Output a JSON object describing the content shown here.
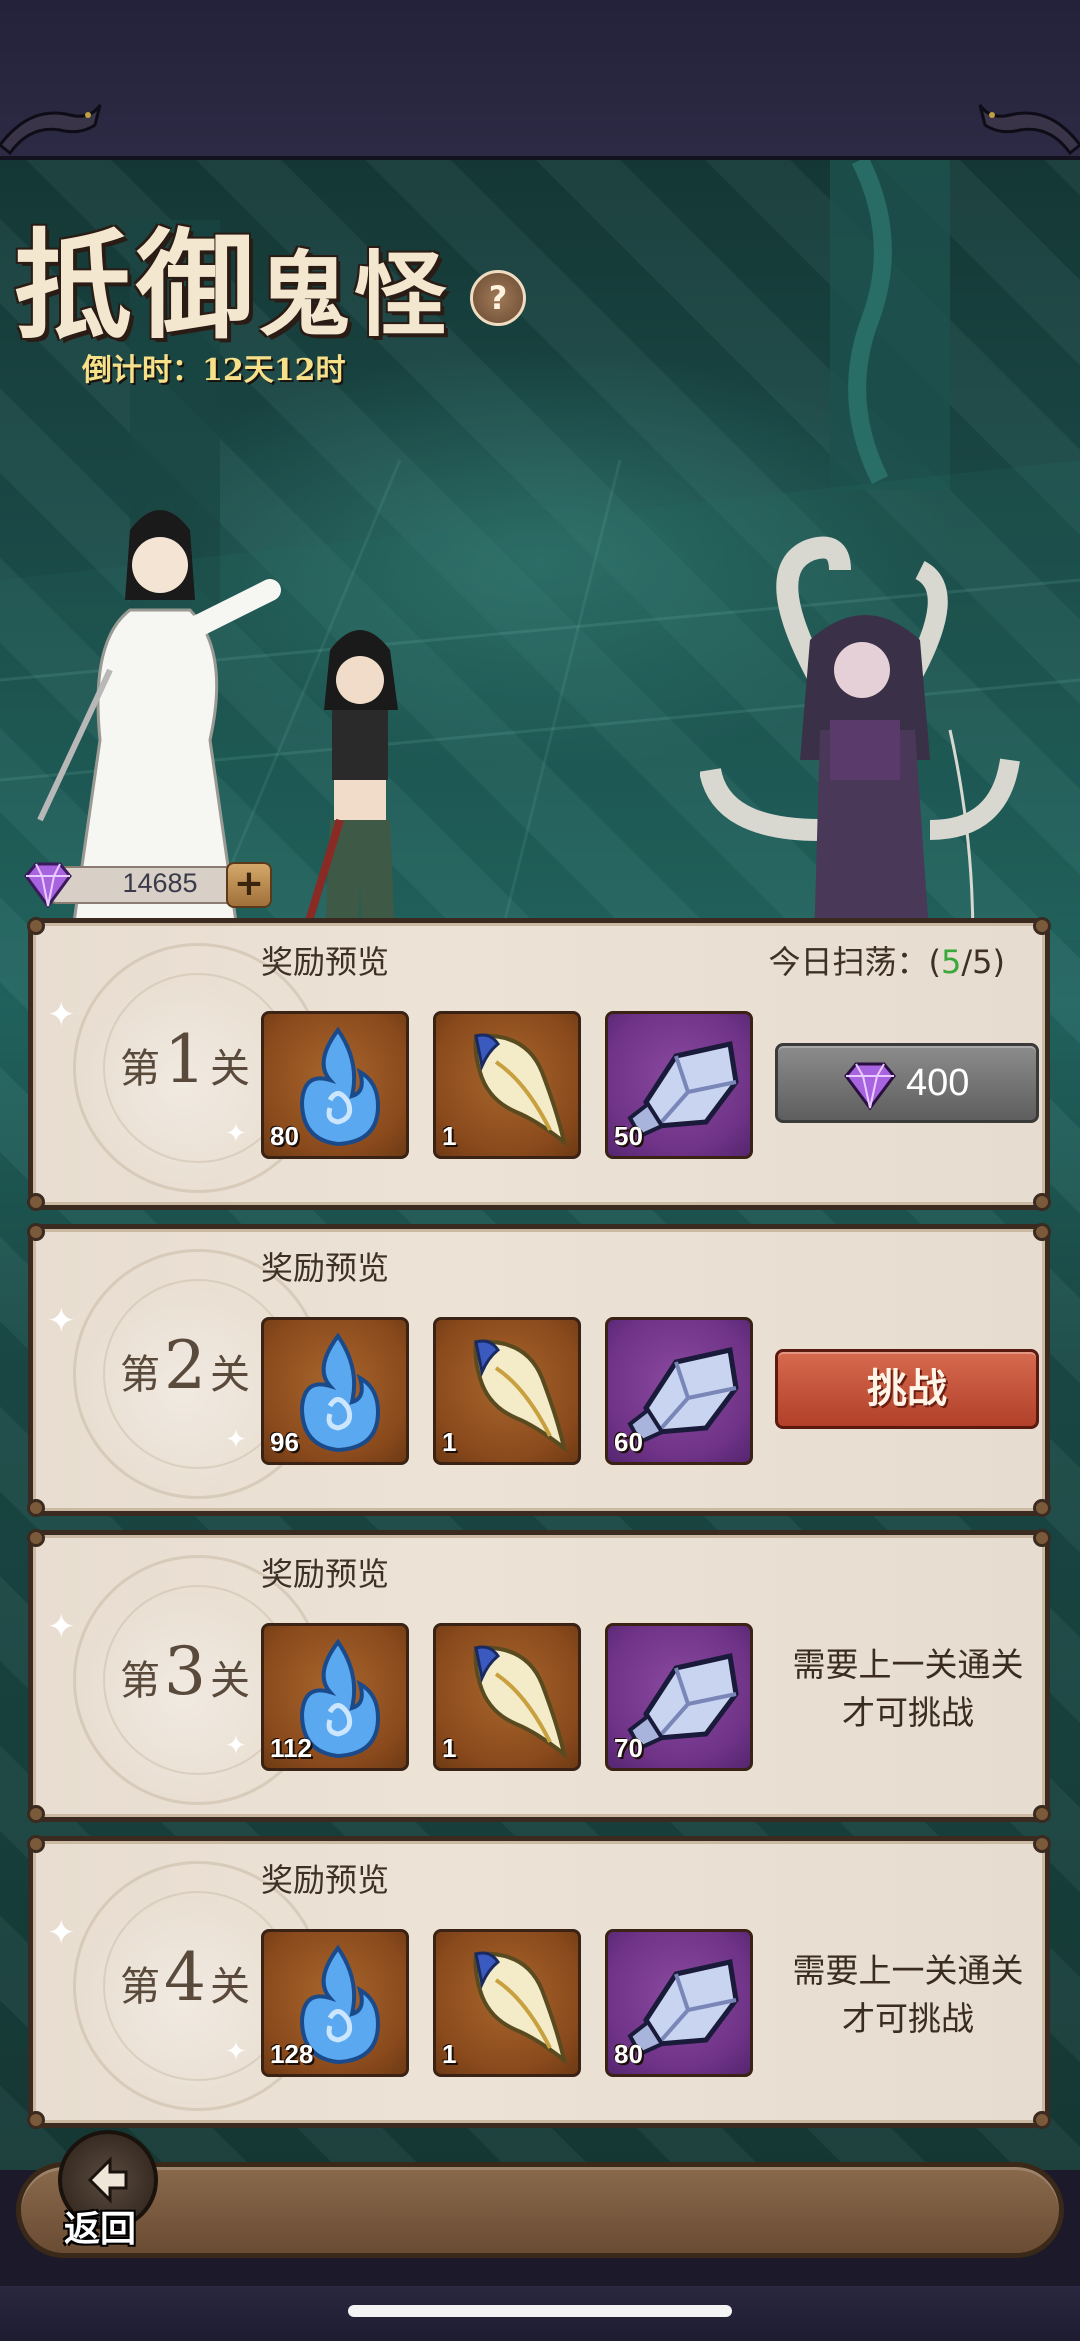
{
  "event": {
    "title_part1": "抵御",
    "title_part2": "鬼怪",
    "help_label": "?",
    "countdown": "倒计时：12天12时"
  },
  "currency": {
    "gems": "14685",
    "add_label": "+"
  },
  "stages": [
    {
      "prefix": "第",
      "number": "1",
      "suffix": "关",
      "preview_label": "奖励预览",
      "sweep_label": "今日扫荡：(",
      "sweep_used": "5",
      "sweep_total": "/5)",
      "rewards": [
        {
          "icon": "blue-flame-icon",
          "count": "80"
        },
        {
          "icon": "claw-fang-icon",
          "count": "1"
        },
        {
          "icon": "crystal-ore-icon",
          "count": "50"
        }
      ],
      "action_type": "sweep",
      "action_value": "400"
    },
    {
      "prefix": "第",
      "number": "2",
      "suffix": "关",
      "preview_label": "奖励预览",
      "rewards": [
        {
          "icon": "blue-flame-icon",
          "count": "96"
        },
        {
          "icon": "claw-fang-icon",
          "count": "1"
        },
        {
          "icon": "crystal-ore-icon",
          "count": "60"
        }
      ],
      "action_type": "challenge",
      "action_value": "挑战"
    },
    {
      "prefix": "第",
      "number": "3",
      "suffix": "关",
      "preview_label": "奖励预览",
      "rewards": [
        {
          "icon": "blue-flame-icon",
          "count": "112"
        },
        {
          "icon": "claw-fang-icon",
          "count": "1"
        },
        {
          "icon": "crystal-ore-icon",
          "count": "70"
        }
      ],
      "action_type": "locked",
      "locked_line1": "需要上一关通关",
      "locked_line2": "才可挑战"
    },
    {
      "prefix": "第",
      "number": "4",
      "suffix": "关",
      "preview_label": "奖励预览",
      "rewards": [
        {
          "icon": "blue-flame-icon",
          "count": "128"
        },
        {
          "icon": "claw-fang-icon",
          "count": "1"
        },
        {
          "icon": "crystal-ore-icon",
          "count": "80"
        }
      ],
      "action_type": "locked",
      "locked_line1": "需要上一关通关",
      "locked_line2": "才可挑战"
    }
  ],
  "footer": {
    "back_label": "返回"
  },
  "colors": {
    "accent_green": "#3aa83a",
    "challenge_red": "#c0503a",
    "card_bg": "#e8ddd0"
  }
}
